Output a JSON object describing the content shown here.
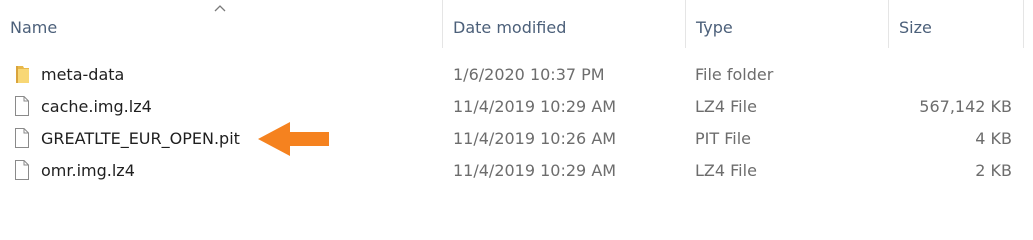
{
  "columns": {
    "name": "Name",
    "date_modified": "Date modified",
    "type": "Type",
    "size": "Size"
  },
  "sort": {
    "column": "name",
    "direction": "ascending",
    "icon": "chevron-up-icon"
  },
  "files": [
    {
      "name": "meta-data",
      "date": "1/6/2020 10:37 PM",
      "type": "File folder",
      "size": "",
      "icon": "folder-icon"
    },
    {
      "name": "cache.img.lz4",
      "date": "11/4/2019 10:29 AM",
      "type": "LZ4 File",
      "size": "567,142 KB",
      "icon": "file-icon"
    },
    {
      "name": "GREATLTE_EUR_OPEN.pit",
      "date": "11/4/2019 10:26 AM",
      "type": "PIT File",
      "size": "4 KB",
      "icon": "file-icon"
    },
    {
      "name": "omr.img.lz4",
      "date": "11/4/2019 10:29 AM",
      "type": "LZ4 File",
      "size": "2 KB",
      "icon": "file-icon"
    }
  ],
  "annotation": {
    "icon": "arrow-left-icon",
    "points_to": "GREATLTE_EUR_OPEN.pit",
    "color": "#f5821f"
  },
  "colors": {
    "header_text": "#4c607a",
    "folder": "#f8d775",
    "folder_dark": "#e8b84a"
  }
}
